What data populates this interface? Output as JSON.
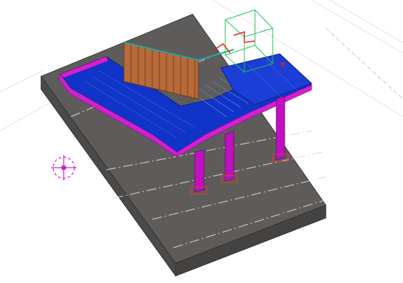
{
  "viewport": {
    "kind": "3d-cad-model-view",
    "background_color": "#ffffff"
  },
  "model": {
    "slab_color": "#5e5c5a",
    "deck_color": "#1030c8",
    "edge_beam_color": "#d020d0",
    "column_color": "#c010c0",
    "railing_color": "#b86a3a",
    "selection_box_color": "#22c24a",
    "axis_indicator_color": "#e02020",
    "gridline_color": "#e8e8e8",
    "centerline_color": "#e6e6e6",
    "column_count": 3
  },
  "icons": {
    "view_cube": "view-orientation-gizmo-icon",
    "axis_indicator": "xyz-axis-indicator-icon"
  }
}
